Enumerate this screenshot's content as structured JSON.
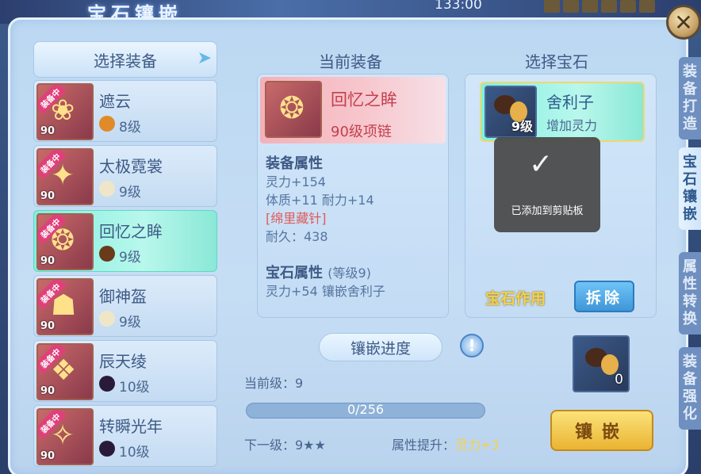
{
  "top": {
    "title": "宝石镶嵌",
    "timer": "133:00"
  },
  "side_tabs": [
    "装备打造",
    "宝石镶嵌",
    "属性转换",
    "装备强化"
  ],
  "left": {
    "header": "选择装备",
    "items": [
      {
        "badge": "装备中",
        "level": "90",
        "name": "遮云",
        "gem_level": "8级",
        "gem_color": "#e08a2a",
        "selected": false
      },
      {
        "badge": "装备中",
        "level": "90",
        "name": "太极霓裳",
        "gem_level": "9级",
        "gem_color": "#efe6c8",
        "selected": false
      },
      {
        "badge": "装备中",
        "level": "90",
        "name": "回忆之眸",
        "gem_level": "9级",
        "gem_color": "#6a3a1a",
        "selected": true
      },
      {
        "badge": "装备中",
        "level": "90",
        "name": "御神盔",
        "gem_level": "9级",
        "gem_color": "#efe6c8",
        "selected": false
      },
      {
        "badge": "装备中",
        "level": "90",
        "name": "辰天绫",
        "gem_level": "10级",
        "gem_color": "#2a1a3a",
        "selected": false
      },
      {
        "badge": "装备中",
        "level": "90",
        "name": "转瞬光年",
        "gem_level": "10级",
        "gem_color": "#2a1a3a",
        "selected": false
      }
    ]
  },
  "middle": {
    "title": "当前装备",
    "item_name": "回忆之眸",
    "item_type": "90级项链",
    "attr_header": "装备属性",
    "attr1": "灵力+154",
    "attr2": "体质+11 耐力+14",
    "special": "[绵里藏针]",
    "durability": "耐久：438",
    "gem_attr_header": "宝石属性",
    "gem_attr_level": "(等级9)",
    "gem_attr": "灵力+54 镶嵌舍利子"
  },
  "right": {
    "title": "选择宝石",
    "gem_name": "舍利子",
    "gem_effect": "增加灵力",
    "gem_level": "9级",
    "toast": "已添加到剪贴板",
    "effect_label": "宝石作用",
    "detach": "拆除"
  },
  "progress": {
    "title": "镶嵌进度",
    "current_level": "当前级：9",
    "progress_text": "0/256",
    "progress_fraction": 0,
    "next_level": "下一级：9★★",
    "attr_up_label": "属性提升：",
    "attr_up_value": "灵力+3",
    "gem_count": "0",
    "inlay_button": "镶嵌"
  }
}
